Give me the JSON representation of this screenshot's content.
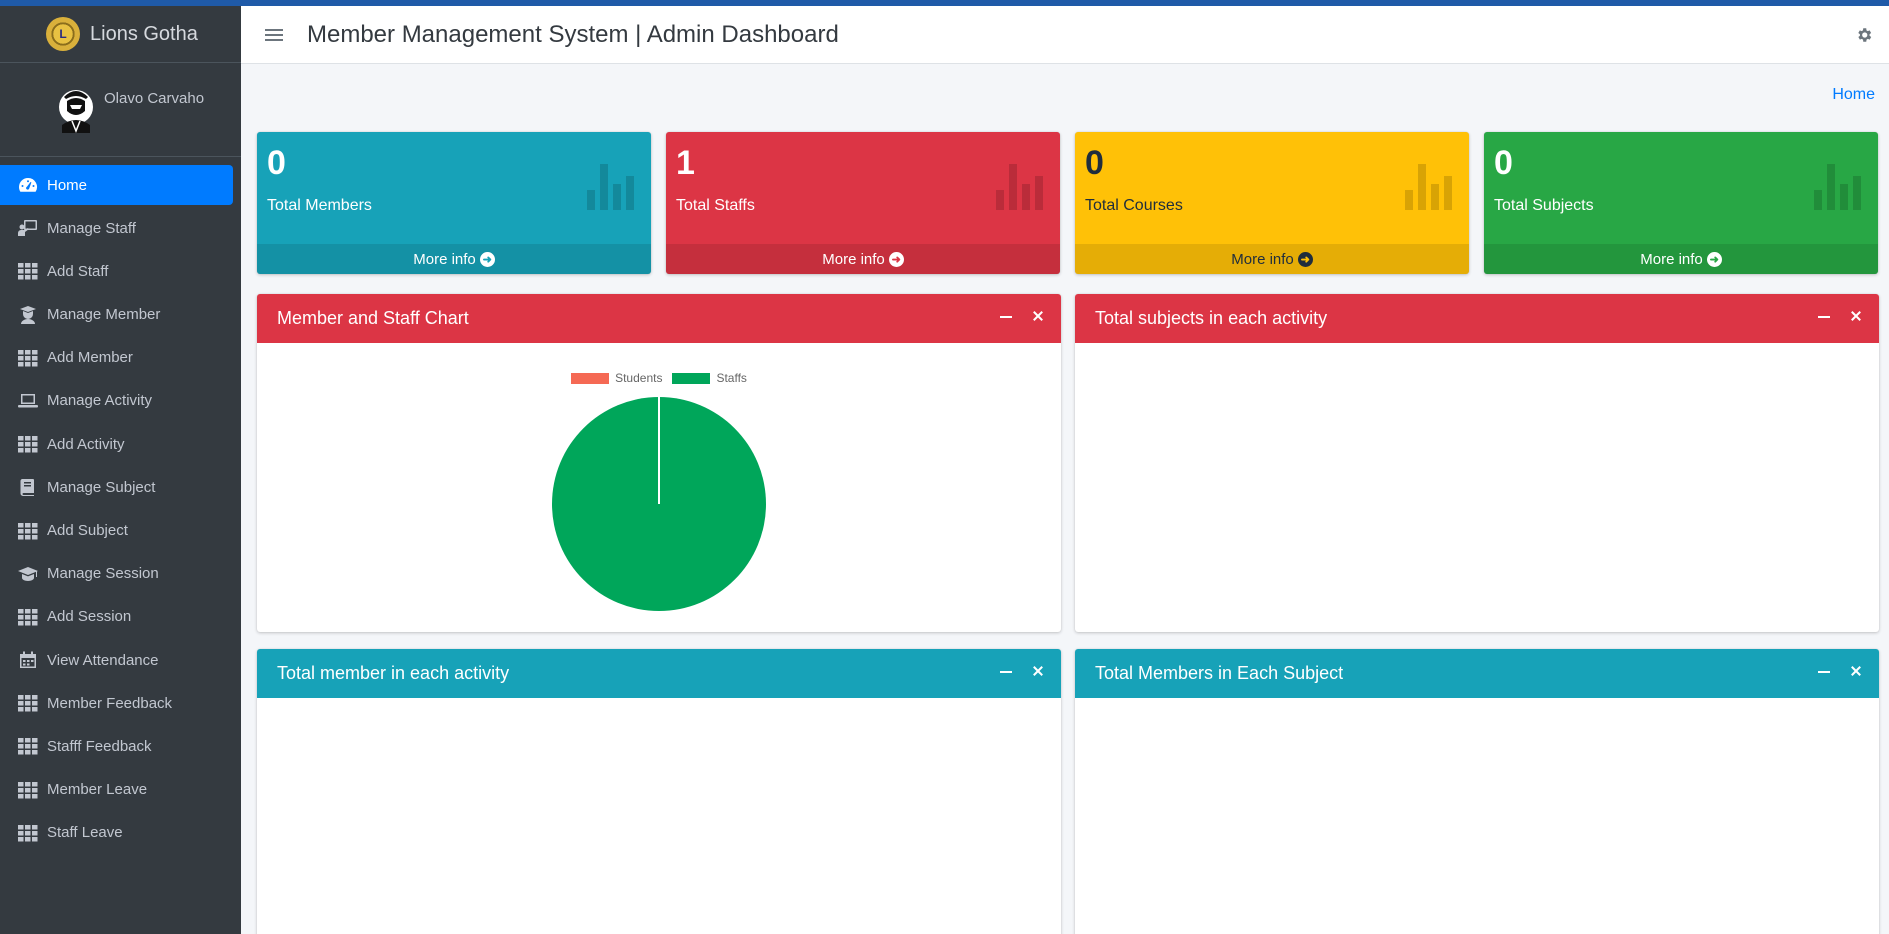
{
  "brand": {
    "name": "Lions Gotha",
    "logo_text": "L"
  },
  "user": {
    "name": "Olavo Carvaho"
  },
  "header": {
    "title": "Member Management System | Admin Dashboard"
  },
  "breadcrumb": {
    "home": "Home"
  },
  "sidebar": {
    "items": [
      {
        "label": "Home",
        "icon": "dashboard-icon",
        "active": true
      },
      {
        "label": "Manage Staff",
        "icon": "chalkboard-teacher-icon"
      },
      {
        "label": "Add Staff",
        "icon": "grid-icon"
      },
      {
        "label": "Manage Member",
        "icon": "user-graduate-icon"
      },
      {
        "label": "Add Member",
        "icon": "grid-icon"
      },
      {
        "label": "Manage Activity",
        "icon": "laptop-icon"
      },
      {
        "label": "Add Activity",
        "icon": "grid-icon"
      },
      {
        "label": "Manage Subject",
        "icon": "book-icon"
      },
      {
        "label": "Add Subject",
        "icon": "grid-icon"
      },
      {
        "label": "Manage Session",
        "icon": "graduation-cap-icon"
      },
      {
        "label": "Add Session",
        "icon": "grid-icon"
      },
      {
        "label": "View Attendance",
        "icon": "calendar-icon"
      },
      {
        "label": "Member Feedback",
        "icon": "grid-icon"
      },
      {
        "label": "Stafff Feedback",
        "icon": "grid-icon"
      },
      {
        "label": "Member Leave",
        "icon": "grid-icon"
      },
      {
        "label": "Staff Leave",
        "icon": "grid-icon"
      }
    ]
  },
  "stats": [
    {
      "value": "0",
      "label": "Total Members",
      "footer": "More info",
      "color": "#17a2b8"
    },
    {
      "value": "1",
      "label": "Total Staffs",
      "footer": "More info",
      "color": "#dc3545"
    },
    {
      "value": "0",
      "label": "Total Courses",
      "footer": "More info",
      "color": "#ffc107"
    },
    {
      "value": "0",
      "label": "Total Subjects",
      "footer": "More info",
      "color": "#28a745"
    }
  ],
  "cards": {
    "member_staff_chart": {
      "title": "Member and Staff Chart"
    },
    "subjects_activity": {
      "title": "Total subjects in each activity"
    },
    "members_activity": {
      "title": "Total member in each activity"
    },
    "members_subject": {
      "title": "Total Members in Each Subject"
    }
  },
  "chart_data": {
    "type": "pie",
    "title": "",
    "categories": [
      "Students",
      "Staffs"
    ],
    "values": [
      0,
      1
    ],
    "colors": [
      "#f56954",
      "#00a65a"
    ],
    "legend": "top"
  }
}
